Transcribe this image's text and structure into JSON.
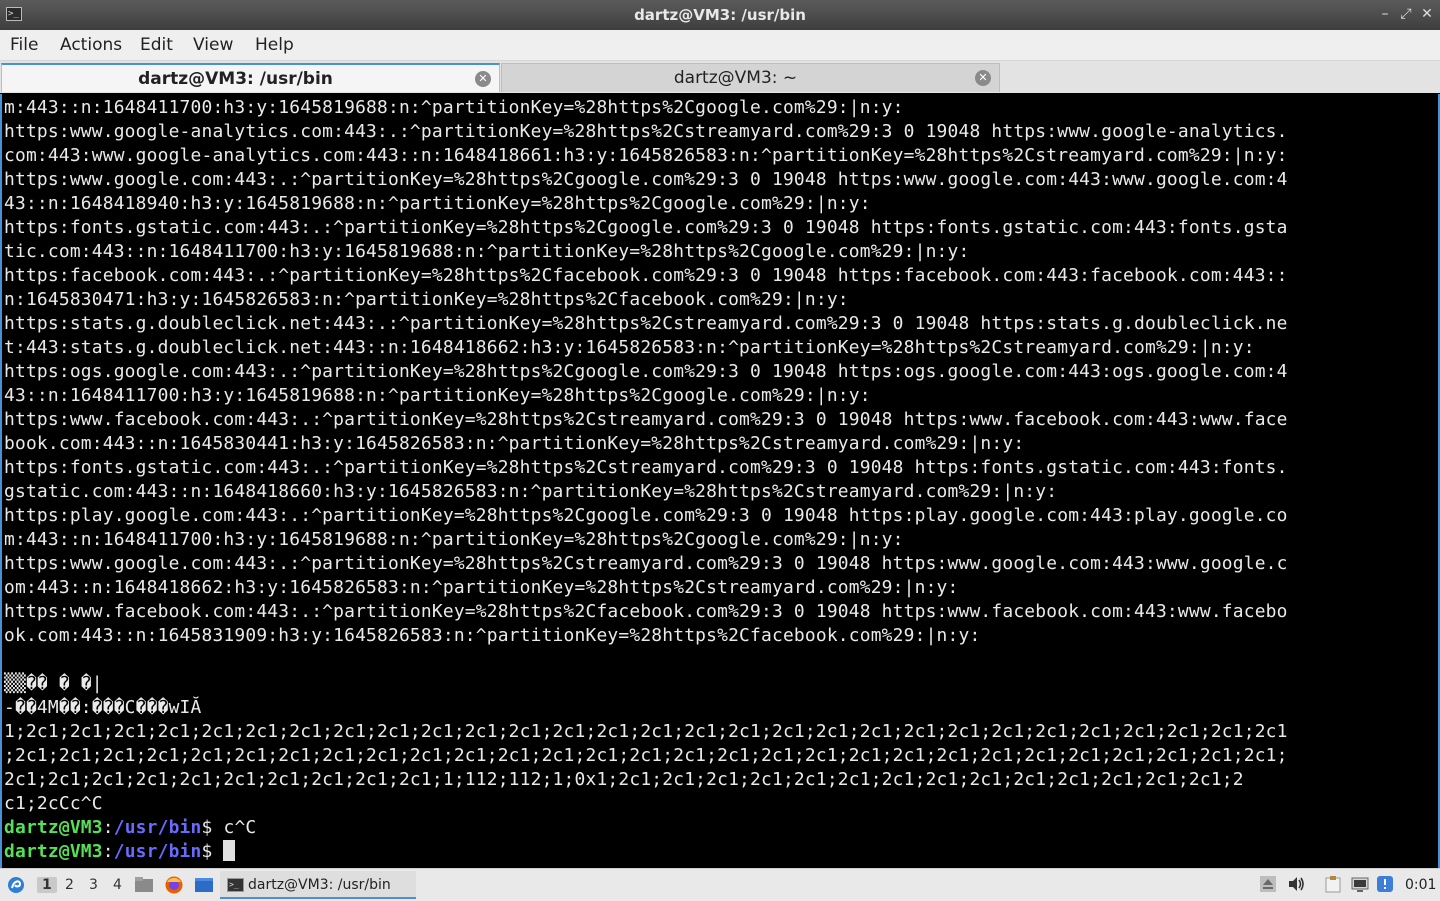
{
  "window": {
    "title": "dartz@VM3: /usr/bin",
    "controls": [
      "–",
      "⤢",
      "✕"
    ]
  },
  "menu": [
    "File",
    "Actions",
    "Edit",
    "View",
    "Help"
  ],
  "tabs": [
    {
      "label": "dartz@VM3: /usr/bin",
      "active": true
    },
    {
      "label": "dartz@VM3: ~",
      "active": false
    }
  ],
  "terminal": {
    "lines": [
      "m:443::n:1648411700:h3:y:1645819688:n:^partitionKey=%28https%2Cgoogle.com%29:|n:y:",
      "https:www.google-analytics.com:443:.:^partitionKey=%28https%2Cstreamyard.com%29:3 0 19048 https:www.google-analytics.",
      "com:443:www.google-analytics.com:443::n:1648418661:h3:y:1645826583:n:^partitionKey=%28https%2Cstreamyard.com%29:|n:y:",
      "https:www.google.com:443:.:^partitionKey=%28https%2Cgoogle.com%29:3 0 19048 https:www.google.com:443:www.google.com:4",
      "43::n:1648418940:h3:y:1645819688:n:^partitionKey=%28https%2Cgoogle.com%29:|n:y:",
      "https:fonts.gstatic.com:443:.:^partitionKey=%28https%2Cgoogle.com%29:3 0 19048 https:fonts.gstatic.com:443:fonts.gsta",
      "tic.com:443::n:1648411700:h3:y:1645819688:n:^partitionKey=%28https%2Cgoogle.com%29:|n:y:",
      "https:facebook.com:443:.:^partitionKey=%28https%2Cfacebook.com%29:3 0 19048 https:facebook.com:443:facebook.com:443::",
      "n:1645830471:h3:y:1645826583:n:^partitionKey=%28https%2Cfacebook.com%29:|n:y:",
      "https:stats.g.doubleclick.net:443:.:^partitionKey=%28https%2Cstreamyard.com%29:3 0 19048 https:stats.g.doubleclick.ne",
      "t:443:stats.g.doubleclick.net:443::n:1648418662:h3:y:1645826583:n:^partitionKey=%28https%2Cstreamyard.com%29:|n:y:",
      "https:ogs.google.com:443:.:^partitionKey=%28https%2Cgoogle.com%29:3 0 19048 https:ogs.google.com:443:ogs.google.com:4",
      "43::n:1648411700:h3:y:1645819688:n:^partitionKey=%28https%2Cgoogle.com%29:|n:y:",
      "https:www.facebook.com:443:.:^partitionKey=%28https%2Cstreamyard.com%29:3 0 19048 https:www.facebook.com:443:www.face",
      "book.com:443::n:1645830441:h3:y:1645826583:n:^partitionKey=%28https%2Cstreamyard.com%29:|n:y:",
      "https:fonts.gstatic.com:443:.:^partitionKey=%28https%2Cstreamyard.com%29:3 0 19048 https:fonts.gstatic.com:443:fonts.",
      "gstatic.com:443::n:1648418660:h3:y:1645826583:n:^partitionKey=%28https%2Cstreamyard.com%29:|n:y:",
      "https:play.google.com:443:.:^partitionKey=%28https%2Cgoogle.com%29:3 0 19048 https:play.google.com:443:play.google.co",
      "m:443::n:1648411700:h3:y:1645819688:n:^partitionKey=%28https%2Cgoogle.com%29:|n:y:",
      "https:www.google.com:443:.:^partitionKey=%28https%2Cstreamyard.com%29:3 0 19048 https:www.google.com:443:www.google.c",
      "om:443::n:1648418662:h3:y:1645826583:n:^partitionKey=%28https%2Cstreamyard.com%29:|n:y:",
      "https:www.facebook.com:443:.:^partitionKey=%28https%2Cfacebook.com%29:3 0 19048 https:www.facebook.com:443:www.facebo",
      "ok.com:443::n:1645831909:h3:y:1645826583:n:^partitionKey=%28https%2Cfacebook.com%29:|n:y:",
      "",
      "▒▒�� � �|",
      "-��4M��:���C���wIĂ",
      "1;2c1;2c1;2c1;2c1;2c1;2c1;2c1;2c1;2c1;2c1;2c1;2c1;2c1;2c1;2c1;2c1;2c1;2c1;2c1;2c1;2c1;2c1;2c1;2c1;2c1;2c1;2c1;2c1;2c1",
      ";2c1;2c1;2c1;2c1;2c1;2c1;2c1;2c1;2c1;2c1;2c1;2c1;2c1;2c1;2c1;2c1;2c1;2c1;2c1;2c1;2c1;2c1;2c1;2c1;2c1;2c1;2c1;2c1;2c1;",
      "2c1;2c1;2c1;2c1;2c1;2c1;2c1;2c1;2c1;2c1;1;112;112;1;0x1;2c1;2c1;2c1;2c1;2c1;2c1;2c1;2c1;2c1;2c1;2c1;2c1;2c1;2c1;2",
      "c1;2cCc^C"
    ],
    "prompts": [
      {
        "user": "dartz@VM3",
        "path": "/usr/bin",
        "symbol": "$ ",
        "command": "c^C"
      },
      {
        "user": "dartz@VM3",
        "path": "/usr/bin",
        "symbol": "$ ",
        "command": ""
      }
    ]
  },
  "taskbar": {
    "workspaces": [
      "1",
      "2",
      "3",
      "4"
    ],
    "task_label": "dartz@VM3: /usr/bin",
    "clock": "0:01"
  },
  "colors": {
    "prompt_user": "#55e055",
    "prompt_path": "#6a6aff",
    "accent": "#4a90d9"
  }
}
